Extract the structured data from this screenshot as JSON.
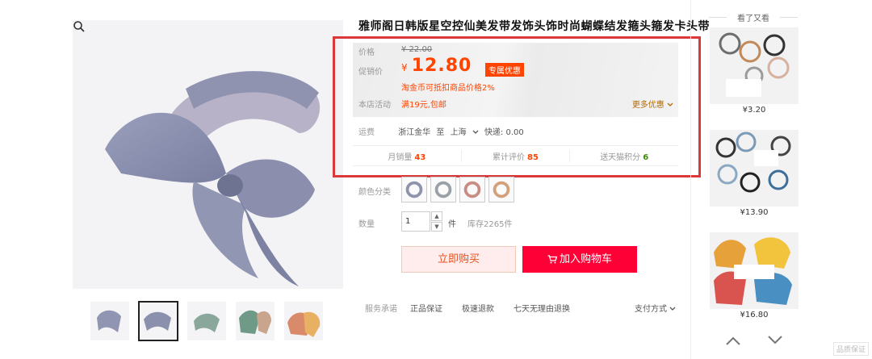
{
  "product": {
    "title": "雅师阁日韩版星空控仙美发带发饰头饰时尚蝴蝶结发箍头箍发卡头带"
  },
  "price_panel": {
    "price_label": "价格",
    "original_price": "¥ 22.00",
    "promo_label": "促销价",
    "promo_currency": "¥",
    "promo_price": "12.80",
    "promo_badge": "专属优惠",
    "coin_note": "淘金币可抵扣商品价格2%",
    "activity_label": "本店活动",
    "activity_text": "满19元,包邮",
    "more_deals": "更多优惠"
  },
  "shipping": {
    "label": "运费",
    "from": "浙江金华",
    "to_word": "至",
    "to": "上海",
    "express": "快递: 0.00"
  },
  "stats": {
    "monthly_sales_label": "月销量",
    "monthly_sales": "43",
    "reviews_label": "累计评价",
    "reviews": "85",
    "points_label": "送天猫积分",
    "points": "6"
  },
  "options": {
    "color_label": "颜色分类",
    "qty_label": "数量",
    "qty_value": "1",
    "qty_unit": "件",
    "stock": "库存2265件"
  },
  "buttons": {
    "buy_now": "立即购买",
    "add_to_cart": "加入购物车"
  },
  "service": {
    "label": "服务承诺",
    "items": [
      "正品保证",
      "极速退款",
      "七天无理由退换"
    ],
    "pay_methods": "支付方式"
  },
  "sidebar": {
    "header": "看了又看",
    "items": [
      {
        "price": "¥3.20"
      },
      {
        "price": "¥13.90"
      },
      {
        "price": "¥16.80"
      }
    ]
  },
  "watermark": "品质保证",
  "icons": {
    "zoom": "magnifier-icon",
    "cart": "cart-icon",
    "dropdown": "chevron-down-icon",
    "scroll_up": "chevron-up-icon",
    "scroll_down": "chevron-down-icon"
  },
  "colors": {
    "accent": "#ff4400",
    "cart_button": "#ff0036",
    "highlight_box": "#d9393a"
  }
}
